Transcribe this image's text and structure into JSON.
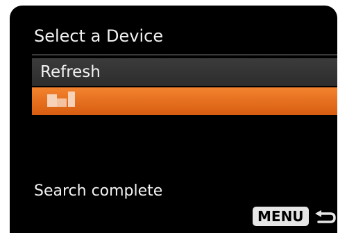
{
  "screen": {
    "title": "Select a Device",
    "items": [
      {
        "label": "Refresh",
        "selected": false
      },
      {
        "label": "",
        "selected": true,
        "note": "pixelated device name"
      }
    ],
    "status": "Search complete",
    "footer": {
      "menu_label": "MENU",
      "back_icon": "return-arrow-icon"
    }
  },
  "colors": {
    "background": "#000000",
    "highlight": "#e8701e",
    "item_background": "#333333",
    "text": "#f2f2f2"
  }
}
